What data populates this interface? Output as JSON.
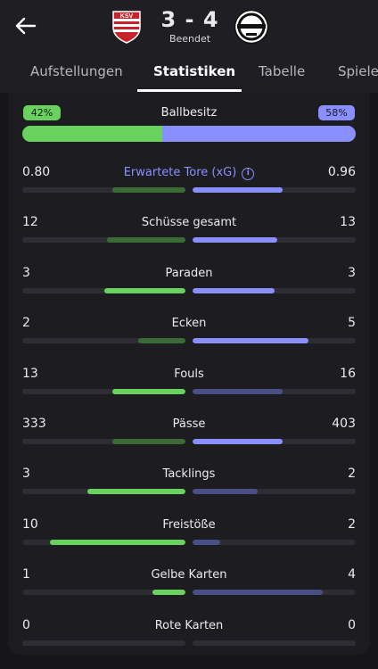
{
  "header": {
    "back_icon": "arrow-left-icon",
    "home_crest": "ksv-crest-icon",
    "away_crest": "club-crest-icon",
    "home_crest_text": "KSV",
    "score": "3 - 4",
    "status": "Beendet"
  },
  "tabs": [
    {
      "label": "Aufstellungen",
      "active": false
    },
    {
      "label": "Statistiken",
      "active": true
    },
    {
      "label": "Tabelle",
      "active": false
    },
    {
      "label": "Spiele",
      "active": false
    }
  ],
  "colors": {
    "home": "#69d25f",
    "home_dim": "#3a6b35",
    "away": "#8a8fff",
    "away_dim": "#4a4d86",
    "background": "#16161a",
    "card": "#1d1d21"
  },
  "possession": {
    "label": "Ballbesitz",
    "home_text": "42%",
    "away_text": "58%",
    "home": 42,
    "away": 58
  },
  "stats": [
    {
      "label": "Erwartete Tore (xG)",
      "home": "0.80",
      "away": "0.96",
      "home_fill": 0.45,
      "away_fill": 0.55,
      "winner": "away",
      "info": true
    },
    {
      "label": "Schüsse gesamt",
      "home": "12",
      "away": "13",
      "home_fill": 0.48,
      "away_fill": 0.52,
      "winner": "away"
    },
    {
      "label": "Paraden",
      "home": "3",
      "away": "3",
      "home_fill": 0.5,
      "away_fill": 0.5,
      "winner": "both"
    },
    {
      "label": "Ecken",
      "home": "2",
      "away": "5",
      "home_fill": 0.29,
      "away_fill": 0.71,
      "winner": "away"
    },
    {
      "label": "Fouls",
      "home": "13",
      "away": "16",
      "home_fill": 0.45,
      "away_fill": 0.55,
      "winner": "home"
    },
    {
      "label": "Pässe",
      "home": "333",
      "away": "403",
      "home_fill": 0.45,
      "away_fill": 0.55,
      "winner": "away"
    },
    {
      "label": "Tacklings",
      "home": "3",
      "away": "2",
      "home_fill": 0.6,
      "away_fill": 0.4,
      "winner": "home"
    },
    {
      "label": "Freistöße",
      "home": "10",
      "away": "2",
      "home_fill": 0.83,
      "away_fill": 0.17,
      "winner": "home"
    },
    {
      "label": "Gelbe Karten",
      "home": "1",
      "away": "4",
      "home_fill": 0.2,
      "away_fill": 0.8,
      "winner": "home"
    },
    {
      "label": "Rote Karten",
      "home": "0",
      "away": "0",
      "home_fill": 0,
      "away_fill": 0,
      "winner": "none"
    }
  ]
}
